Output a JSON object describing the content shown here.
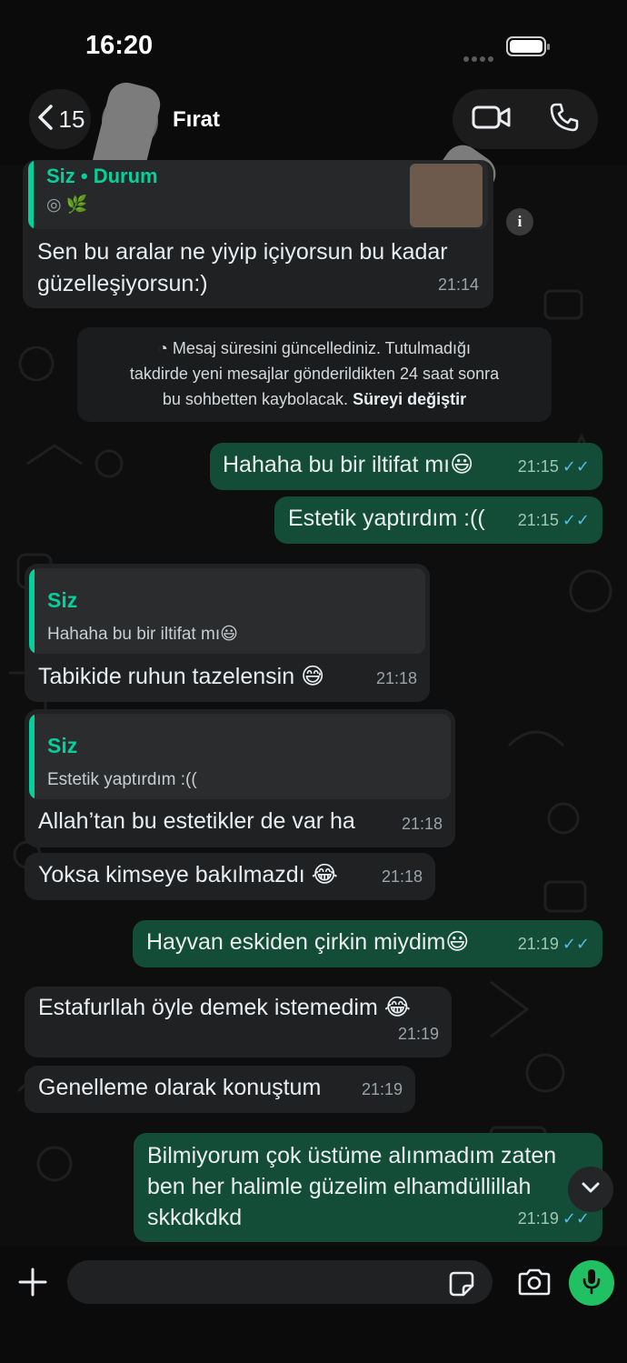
{
  "status_bar": {
    "time": "16:20"
  },
  "header": {
    "back_count": "15",
    "contact_name": "Fırat"
  },
  "status_reply": {
    "label": "Siz • Durum",
    "emojis": "◎ 🌿",
    "text_line1": "Sen bu aralar ne yiyip içiyorsun bu kadar",
    "text_line2": "güzelleşiyorsun:)",
    "time": "21:14"
  },
  "system_note": {
    "line1": "Mesaj süresini güncellediniz. Tutulmadığı",
    "line2": "takdirde yeni mesajlar gönderildikten 24 saat sonra",
    "line3": "bu sohbetten kaybolacak.",
    "link": "Süreyi değiştir"
  },
  "messages": [
    {
      "text": "Hahaha bu bir iltifat mı😃",
      "time": "21:15",
      "tick": "✓✓"
    },
    {
      "text": "Estetik yaptırdım :((",
      "time": "21:15",
      "tick": "✓✓"
    },
    {
      "quote_who": "Siz",
      "quote_text": "Hahaha bu bir iltifat mı😃",
      "text": "Tabikide ruhun tazelensin 😅",
      "time": "21:18"
    },
    {
      "quote_who": "Siz",
      "quote_text": "Estetik yaptırdım :((",
      "text": "Allah’tan bu estetikler de var ha",
      "time": "21:18"
    },
    {
      "text": "Yoksa kimseye bakılmazdı 😂",
      "time": "21:18"
    },
    {
      "text": "Hayvan eskiden çirkin miydim😃",
      "time": "21:19",
      "tick": "✓✓"
    },
    {
      "text": "Estafurllah öyle demek istemedim 😂",
      "time": "21:19"
    },
    {
      "text": "Genelleme olarak konuştum",
      "time": "21:19"
    },
    {
      "line1": "Bilmiyorum çok üstüme alınmadım zaten",
      "line2": "ben her halimle güzelim elhamdüllillah",
      "line3": "skkdkdkd",
      "time": "21:19",
      "tick": "✓✓"
    }
  ],
  "input": {
    "placeholder": ""
  },
  "colors": {
    "outgoing": "#134d37",
    "incoming": "#1f2123",
    "accent": "#06cf9c",
    "read_tick": "#53bdeb",
    "mic": "#21c063"
  },
  "icons": [
    "chevron-left-icon",
    "video-camera-icon",
    "phone-icon",
    "info-icon",
    "timer-icon",
    "chevron-down-icon",
    "plus-icon",
    "sticker-icon",
    "camera-icon",
    "microphone-icon"
  ]
}
